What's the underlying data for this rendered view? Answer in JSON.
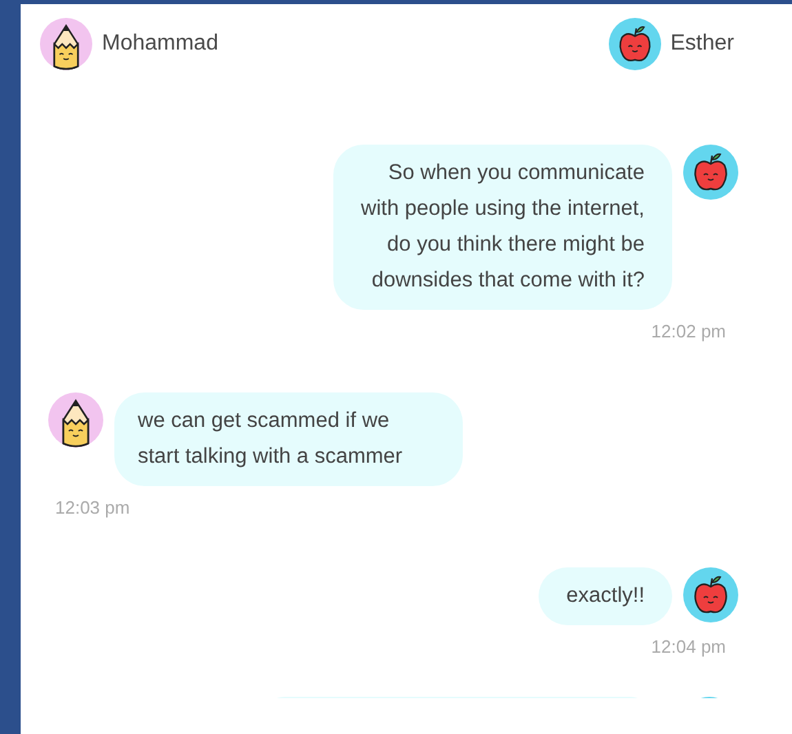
{
  "participants": [
    {
      "name": "Mohammad",
      "kind": "pencil"
    },
    {
      "name": "Esther",
      "kind": "apple"
    }
  ],
  "messages": [
    {
      "kind": "outgoing",
      "lines": [
        "So when you communicate",
        "with people using the internet,",
        "do you think there might be",
        "downsides that come with it?"
      ],
      "time": "12:02 pm"
    },
    {
      "kind": "incoming",
      "lines": [
        "we can get scammed if we",
        "start talking with a scammer"
      ],
      "time": "12:03 pm"
    },
    {
      "kind": "outgoing",
      "lines": [
        "exactly!!"
      ],
      "time": "12:04 pm"
    }
  ]
}
